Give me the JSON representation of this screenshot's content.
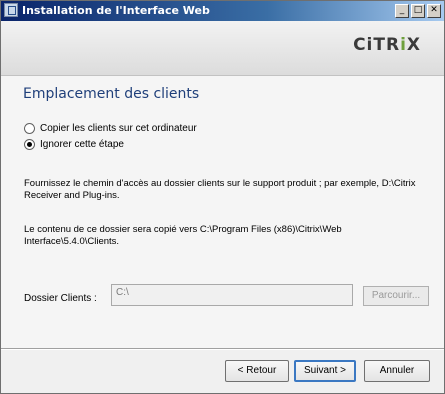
{
  "window": {
    "title": "Installation de l'Interface Web",
    "minimize_glyph": "_",
    "maximize_glyph": "□",
    "close_glyph": "✕"
  },
  "banner": {
    "logo_prefix": "CiTR",
    "logo_mark": "i",
    "logo_suffix": "X"
  },
  "page": {
    "heading": "Emplacement des clients",
    "options": [
      {
        "label": "Copier les clients sur cet ordinateur",
        "checked": false
      },
      {
        "label": "Ignorer cette étape",
        "checked": true
      }
    ],
    "instruction": "Fournissez le chemin d'accès au dossier clients sur le support produit ; par exemple, D:\\Citrix Receiver and Plug-ins.",
    "copy_note": "Le contenu de ce dossier sera copié vers C:\\Program Files (x86)\\Citrix\\Web Interface\\5.4.0\\Clients.",
    "folder_label": "Dossier Clients :",
    "folder_value": "C:\\",
    "browse_label": "Parcourir..."
  },
  "footer": {
    "back_label": "< Retour",
    "next_label": "Suivant >",
    "cancel_label": "Annuler"
  }
}
